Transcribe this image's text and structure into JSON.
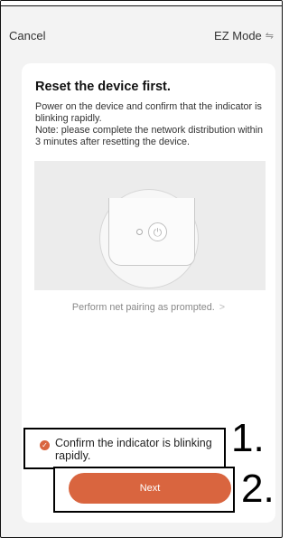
{
  "navbar": {
    "cancel_label": "Cancel",
    "mode_label": "EZ Mode",
    "swap_icon": "⇋"
  },
  "content": {
    "title": "Reset the device first.",
    "description": "Power on the device and confirm that the indicator is blinking rapidly.\nNote: please complete the network distribution within 3 minutes after resetting the device.",
    "perform_link": "Perform net pairing as prompted.",
    "perform_link_chevron": ">"
  },
  "confirm": {
    "text": "Confirm the indicator is blinking rapidly.",
    "checked": true
  },
  "next_button_label": "Next",
  "annotations": {
    "label_1": "1.",
    "label_2": "2."
  },
  "colors": {
    "accent": "#d9653f",
    "card_bg": "#ffffff",
    "page_bg": "#f3f3f3"
  }
}
